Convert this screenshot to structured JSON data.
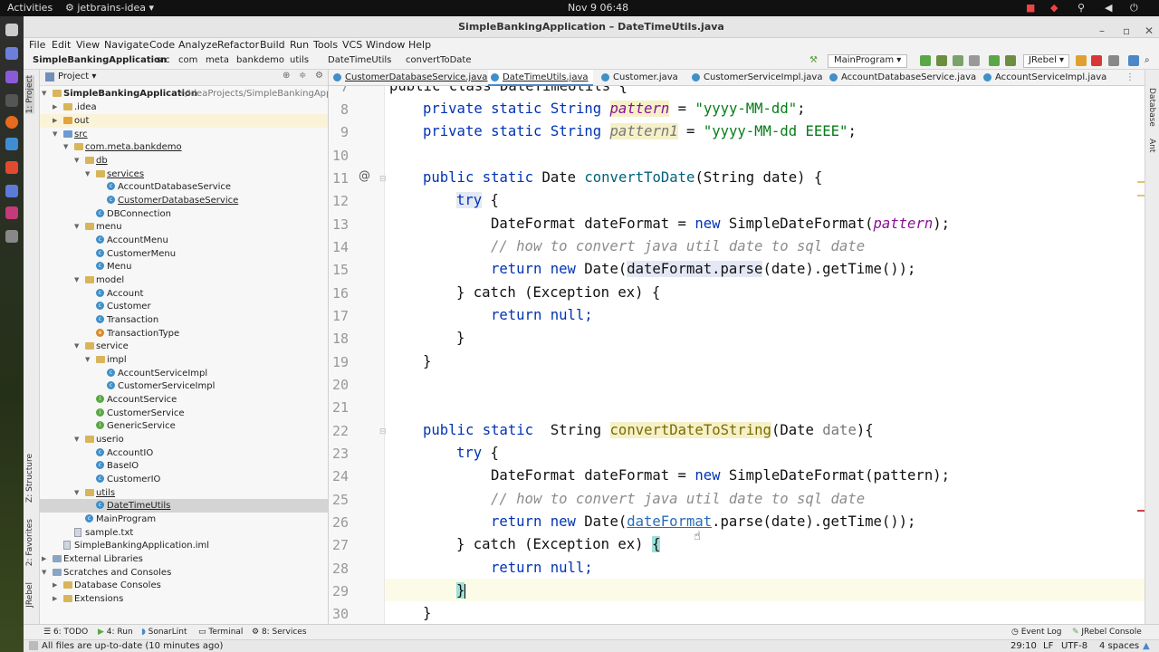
{
  "system": {
    "activities": "Activities",
    "app": "jetbrains-idea ▾",
    "clock": "Nov 9  06:48"
  },
  "window": {
    "title": "SimpleBankingApplication – DateTimeUtils.java"
  },
  "menu": [
    "File",
    "Edit",
    "View",
    "Navigate",
    "Code",
    "Analyze",
    "Refactor",
    "Build",
    "Run",
    "Tools",
    "VCS",
    "Window",
    "Help"
  ],
  "breadcrumbs": [
    "SimpleBankingApplication",
    "src",
    "com",
    "meta",
    "bankdemo",
    "utils",
    "DateTimeUtils",
    "convertToDate"
  ],
  "run_config": "MainProgram ▾",
  "jrebel_btn": "JRebel ▾",
  "project": {
    "header": "Project ▾",
    "root_label": "SimpleBankingApplication",
    "root_path": " ~/IdeaProjects/SimpleBankingAppli",
    "rows": [
      ".idea",
      "out",
      "src",
      "com.meta.bankdemo",
      "db",
      "services",
      "AccountDatabaseService",
      "CustomerDatabaseService",
      "DBConnection",
      "menu",
      "AccountMenu",
      "CustomerMenu",
      "Menu",
      "model",
      "Account",
      "Customer",
      "Transaction",
      "TransactionType",
      "service",
      "impl",
      "AccountServiceImpl",
      "CustomerServiceImpl",
      "AccountService",
      "CustomerService",
      "GenericService",
      "userio",
      "AccountIO",
      "BaseIO",
      "CustomerIO",
      "utils",
      "DateTimeUtils",
      "MainProgram",
      "sample.txt",
      "SimpleBankingApplication.iml",
      "External Libraries",
      "Scratches and Consoles",
      "Database Consoles",
      "Extensions"
    ]
  },
  "left_tools": [
    "1: Project",
    "Z: Structure",
    "2: Favorites",
    "JRebel"
  ],
  "right_tools": [
    "Database",
    "Ant"
  ],
  "tabs": [
    "CustomerDatabaseService.java",
    "DateTimeUtils.java",
    "Customer.java",
    "CustomerServiceImpl.java",
    "AccountDatabaseService.java",
    "AccountServiceImpl.java"
  ],
  "code": {
    "line_numbers": [
      "7",
      "8",
      "9",
      "10",
      "11",
      "12",
      "13",
      "14",
      "15",
      "16",
      "17",
      "18",
      "19",
      "20",
      "21",
      "22",
      "23",
      "24",
      "25",
      "26",
      "27",
      "28",
      "29",
      "30"
    ],
    "t": {
      "l7": "public class DateTimeUtils {",
      "private_static_String": "private static String ",
      "pattern": "pattern",
      "pattern1": "pattern1",
      "eq": " = ",
      "fmt1": "\"yyyy-MM-dd\"",
      "fmt2": "\"yyyy-MM-dd EEEE\"",
      "semi": ";",
      "public_static": "public static ",
      "Date": "Date ",
      "convertToDate": "convertToDate",
      "sig1": "(String date) {",
      "try": "try",
      "brace_open": " {",
      "df_decl": "DateFormat dateFormat = ",
      "new": "new ",
      "sdf": "SimpleDateFormat(",
      "close_semi": ");",
      "comment": "// how to convert java util date to sql date",
      "return_new": "return new ",
      "date_open": "Date(",
      "dateFormat_parse": "dateFormat.parse",
      "rest15": "(date).getTime());",
      "catch": "} catch (Exception ex) {",
      "return_null": "return null;",
      "close": "}",
      "public_static2": "public static  ",
      "String": "String ",
      "convertDateToString": "convertDateToString",
      "sig2a": "(Date ",
      "date_param": "date",
      "sig2b": "){",
      "sdf_line24": "SimpleDateFormat(pattern);",
      "dateFormat": "dateFormat",
      "rest26": ".parse(date).getTime());",
      "catch_a": "} catch (Exception ex) ",
      "brace": "{",
      "at": "@"
    }
  },
  "bottom_tools": [
    "6: TODO",
    "4: Run",
    "SonarLint",
    "Terminal",
    "8: Services"
  ],
  "bottom_right": [
    "Event Log",
    "JRebel Console"
  ],
  "status": {
    "message": "All files are up-to-date (10 minutes ago)",
    "position": "29:10",
    "line_sep": "LF",
    "encoding": "UTF-8",
    "indent": "4 spaces"
  },
  "colors": {
    "keyword": "#0033b3",
    "field": "#871094",
    "string": "#067d17",
    "comment": "#8c8c8c",
    "method": "#00627a"
  }
}
